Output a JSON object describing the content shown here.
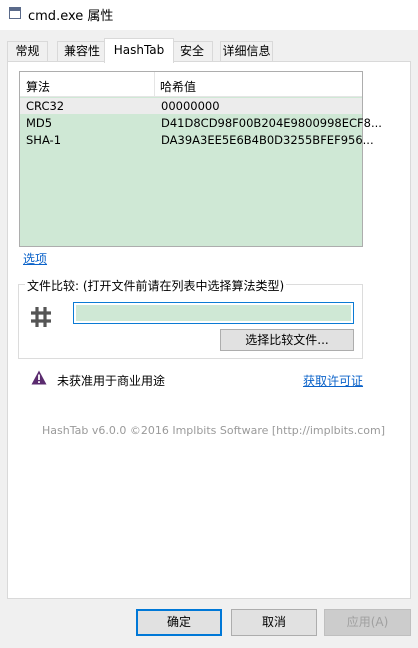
{
  "window": {
    "title": "cmd.exe 属性",
    "icon": "console-window-icon"
  },
  "tabs": [
    {
      "label": "常规",
      "active": false
    },
    {
      "label": "兼容性",
      "active": false
    },
    {
      "label": "HashTab",
      "active": true
    },
    {
      "label": "安全",
      "active": false
    },
    {
      "label": "详细信息",
      "active": false
    }
  ],
  "hash_list": {
    "columns": [
      "算法",
      "哈希值"
    ],
    "rows": [
      {
        "algorithm": "CRC32",
        "value": "00000000"
      },
      {
        "algorithm": "MD5",
        "value": "D41D8CD98F00B204E9800998ECF8..."
      },
      {
        "algorithm": "SHA-1",
        "value": "DA39A3EE5E6B4B0D3255BFEF956..."
      }
    ],
    "background": "#cfe8d5"
  },
  "options_link": "选项",
  "compare": {
    "group_label": "文件比较: (打开文件前请在列表中选择算法类型)",
    "icon": "hash-icon",
    "field_value": "",
    "choose_button": "选择比较文件..."
  },
  "notice": {
    "icon": "warning-icon",
    "text": "未获准用于商业用途",
    "license_link": "获取许可证"
  },
  "footer": "HashTab v6.0.0 ©2016 Implbits Software [http://implbits.com]",
  "buttons": {
    "ok": "确定",
    "cancel": "取消",
    "apply": "应用(A)"
  },
  "colors": {
    "link": "#0a62c9",
    "accent": "#0078d7"
  }
}
